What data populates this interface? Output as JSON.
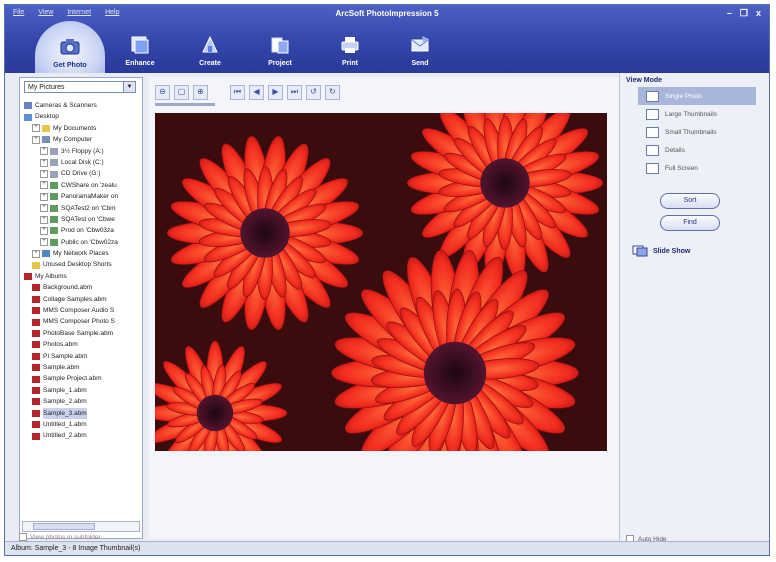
{
  "menu": [
    "File",
    "View",
    "Internet",
    "Help"
  ],
  "app_title": "ArcSoft PhotoImpression 5",
  "window_buttons": {
    "minimize": "–",
    "restore": "❐",
    "close": "x"
  },
  "tabs": [
    {
      "label": "Get Photo",
      "icon": "camera-icon"
    },
    {
      "label": "Enhance",
      "icon": "enhance-icon"
    },
    {
      "label": "Create",
      "icon": "create-icon"
    },
    {
      "label": "Project",
      "icon": "project-icon"
    },
    {
      "label": "Print",
      "icon": "print-icon"
    },
    {
      "label": "Send",
      "icon": "send-icon"
    }
  ],
  "folder_combo": {
    "value": "My Pictures"
  },
  "tree": [
    {
      "label": "Cameras & Scanners",
      "level": 0,
      "icon": "camera-icon",
      "plus": false
    },
    {
      "label": "Desktop",
      "level": 0,
      "icon": "desktop-icon",
      "plus": false
    },
    {
      "label": "My Documents",
      "level": 1,
      "icon": "folder-icon",
      "plus": true
    },
    {
      "label": "My Computer",
      "level": 1,
      "icon": "computer-icon",
      "plus": true
    },
    {
      "label": "3½ Floppy (A:)",
      "level": 2,
      "icon": "drive-icon",
      "plus": true
    },
    {
      "label": "Local Disk (C:)",
      "level": 2,
      "icon": "drive-icon",
      "plus": true
    },
    {
      "label": "CD Drive (G:)",
      "level": 2,
      "icon": "drive-icon",
      "plus": true
    },
    {
      "label": "CWShare on 'zealu",
      "level": 2,
      "icon": "network-drive-icon",
      "plus": true
    },
    {
      "label": "PanoramaMaker on",
      "level": 2,
      "icon": "network-drive-icon",
      "plus": true
    },
    {
      "label": "SQATest2 on 'Cbm",
      "level": 2,
      "icon": "network-drive-icon",
      "plus": true
    },
    {
      "label": "SQATest on 'Cbwe",
      "level": 2,
      "icon": "network-drive-icon",
      "plus": true
    },
    {
      "label": "Prod on 'Cbw03za",
      "level": 2,
      "icon": "network-drive-icon",
      "plus": true
    },
    {
      "label": "Public on 'Cbw02za",
      "level": 2,
      "icon": "network-drive-icon",
      "plus": true
    },
    {
      "label": "My Network Places",
      "level": 1,
      "icon": "network-icon",
      "plus": true
    },
    {
      "label": "Unused Desktop Shorts",
      "level": 1,
      "icon": "folder-icon",
      "plus": false
    },
    {
      "label": "My Albums",
      "level": 0,
      "icon": "album-icon",
      "plus": false
    },
    {
      "label": "Background.abm",
      "level": 1,
      "icon": "album-icon",
      "plus": false
    },
    {
      "label": "Collage Samples.abm",
      "level": 1,
      "icon": "album-icon",
      "plus": false
    },
    {
      "label": "MMS Composer Audio S",
      "level": 1,
      "icon": "album-icon",
      "plus": false
    },
    {
      "label": "MMS Composer Photo S",
      "level": 1,
      "icon": "album-icon",
      "plus": false
    },
    {
      "label": "PhotoBase Sample.abm",
      "level": 1,
      "icon": "album-icon",
      "plus": false
    },
    {
      "label": "Photos.abm",
      "level": 1,
      "icon": "album-icon",
      "plus": false
    },
    {
      "label": "PI Sample.abm",
      "level": 1,
      "icon": "album-icon",
      "plus": false
    },
    {
      "label": "Sample.abm",
      "level": 1,
      "icon": "album-icon",
      "plus": false
    },
    {
      "label": "Sample Project.abm",
      "level": 1,
      "icon": "album-icon",
      "plus": false
    },
    {
      "label": "Sample_1.abm",
      "level": 1,
      "icon": "album-icon",
      "plus": false
    },
    {
      "label": "Sample_2.abm",
      "level": 1,
      "icon": "album-icon",
      "plus": false
    },
    {
      "label": "Sample_3.abm",
      "level": 1,
      "icon": "album-icon",
      "plus": false,
      "selected": true
    },
    {
      "label": "Untitled_1.abm",
      "level": 1,
      "icon": "album-icon",
      "plus": false
    },
    {
      "label": "Untitled_2.abm",
      "level": 1,
      "icon": "album-icon",
      "plus": false
    }
  ],
  "view_photos_subfolder": "View photos in subfolder",
  "view_mode": {
    "title": "View Mode",
    "items": [
      {
        "label": "Single Photo",
        "active": true
      },
      {
        "label": "Large Thumbnails",
        "active": false
      },
      {
        "label": "Small Thumbnails",
        "active": false
      },
      {
        "label": "Details",
        "active": false
      },
      {
        "label": "Full Screen",
        "active": false
      }
    ]
  },
  "sort_label": "Sort",
  "find_label": "Find",
  "slide_show_label": "Slide Show",
  "auto_hide_label": "Auto Hide",
  "status_text": "Album: Sample_3 - 8 Image Thumbnail(s)",
  "colors": {
    "title_bar": "#3446aa",
    "accent": "#5c6eaa"
  }
}
